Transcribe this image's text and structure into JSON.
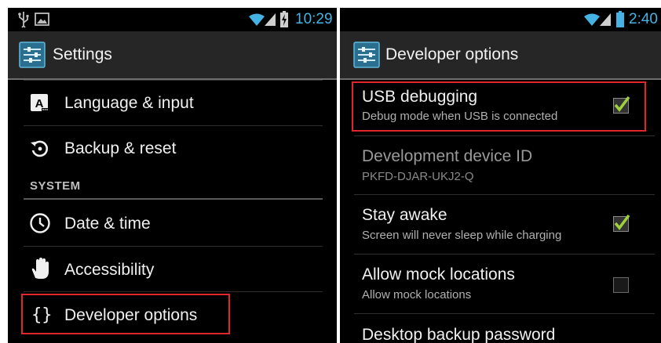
{
  "left_screen": {
    "status_time": "10:29",
    "title": "Settings",
    "items": [
      {
        "label": "Language & input",
        "icon": "language-icon"
      },
      {
        "label": "Backup & reset",
        "icon": "backup-icon"
      },
      {
        "label": "Date & time",
        "icon": "clock-icon"
      },
      {
        "label": "Accessibility",
        "icon": "hand-icon"
      },
      {
        "label": "Developer options",
        "icon": "braces-icon"
      }
    ],
    "section_header": "SYSTEM"
  },
  "right_screen": {
    "status_time": "2:40",
    "title": "Developer options",
    "items": [
      {
        "title": "USB debugging",
        "summary": "Debug mode when USB is connected",
        "checked": true,
        "enabled": true
      },
      {
        "title": "Development device ID",
        "summary": "PKFD-DJAR-UKJ2-Q",
        "enabled": false
      },
      {
        "title": "Stay awake",
        "summary": "Screen will never sleep while charging",
        "checked": true,
        "enabled": true
      },
      {
        "title": "Allow mock locations",
        "summary": "Allow mock locations",
        "checked": false,
        "enabled": true
      },
      {
        "title": "Desktop backup password",
        "enabled": true
      }
    ]
  },
  "colors": {
    "accent": "#44b3e3",
    "highlight_box": "#e0262b",
    "check": "#9fd13c"
  }
}
